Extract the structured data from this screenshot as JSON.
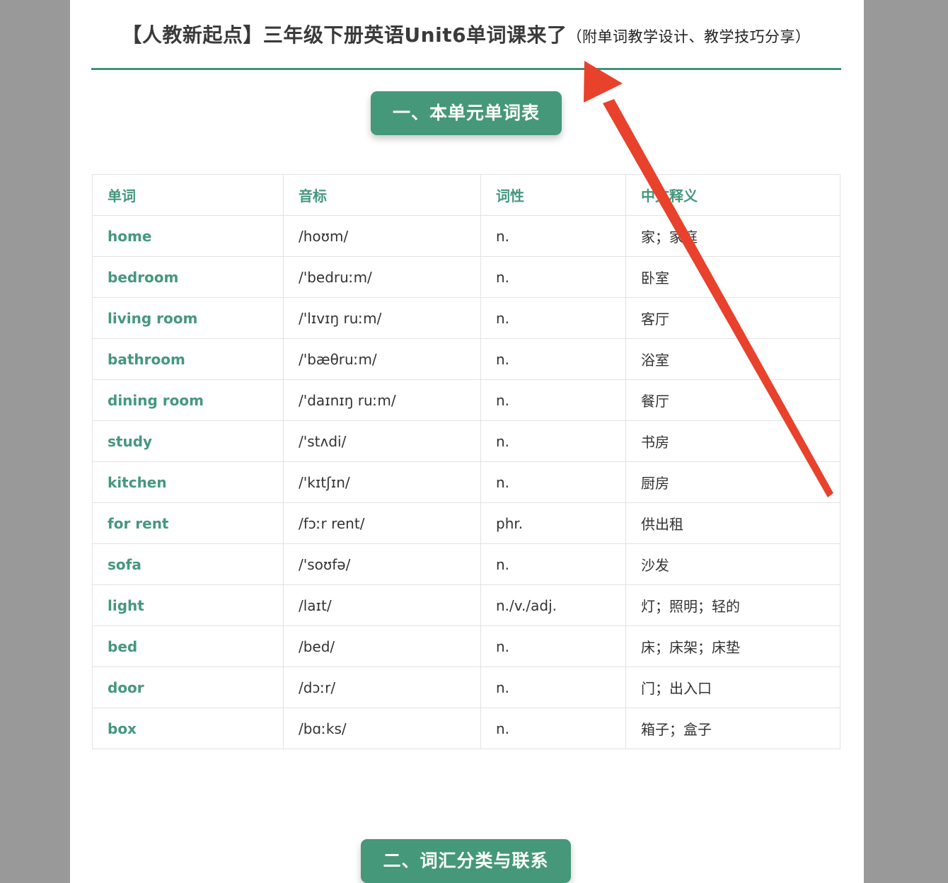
{
  "document": {
    "title_main": "【人教新起点】三年级下册英语Unit6单词课来了",
    "title_sub": "（附单词教学设计、教学技巧分享）",
    "section1_label": "一、本单元单词表",
    "section2_label": "二、词汇分类与联系"
  },
  "table": {
    "headers": [
      "单词",
      "音标",
      "词性",
      "中文释义"
    ],
    "rows": [
      {
        "word": "home",
        "phonetic": "/hoʊm/",
        "pos": "n.",
        "meaning": "家；家庭"
      },
      {
        "word": "bedroom",
        "phonetic": "/'bedruːm/",
        "pos": "n.",
        "meaning": "卧室"
      },
      {
        "word": "living room",
        "phonetic": "/'lɪvɪŋ ruːm/",
        "pos": "n.",
        "meaning": "客厅"
      },
      {
        "word": "bathroom",
        "phonetic": "/'bæθruːm/",
        "pos": "n.",
        "meaning": "浴室"
      },
      {
        "word": "dining room",
        "phonetic": "/'daɪnɪŋ ruːm/",
        "pos": "n.",
        "meaning": "餐厅"
      },
      {
        "word": "study",
        "phonetic": "/'stʌdi/",
        "pos": "n.",
        "meaning": "书房"
      },
      {
        "word": "kitchen",
        "phonetic": "/'kɪtʃɪn/",
        "pos": "n.",
        "meaning": "厨房"
      },
      {
        "word": "for rent",
        "phonetic": "/fɔːr rent/",
        "pos": "phr.",
        "meaning": "供出租"
      },
      {
        "word": "sofa",
        "phonetic": "/'soʊfə/",
        "pos": "n.",
        "meaning": "沙发"
      },
      {
        "word": "light",
        "phonetic": "/laɪt/",
        "pos": "n./v./adj.",
        "meaning": "灯；照明；轻的"
      },
      {
        "word": "bed",
        "phonetic": "/bed/",
        "pos": "n.",
        "meaning": "床；床架；床垫"
      },
      {
        "word": "door",
        "phonetic": "/dɔːr/",
        "pos": "n.",
        "meaning": "门；出入口"
      },
      {
        "word": "box",
        "phonetic": "/bɑːks/",
        "pos": "n.",
        "meaning": "箱子；盒子"
      }
    ]
  },
  "annotation": {
    "arrow_color": "#e8412c",
    "accent_color": "#45987a"
  }
}
